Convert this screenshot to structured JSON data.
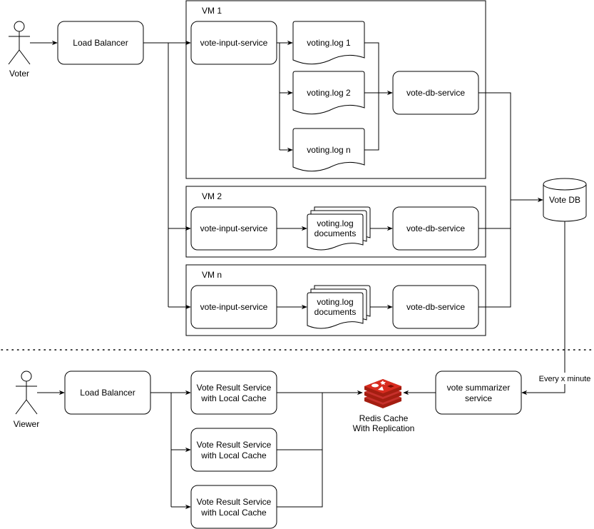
{
  "write_path": {
    "actor": "Voter",
    "load_balancer": "Load Balancer",
    "vms": [
      {
        "title": "VM 1",
        "input_service": "vote-input-service",
        "logs": [
          "voting.log 1",
          "voting.log 2",
          "voting.log n"
        ],
        "db_service": "vote-db-service"
      },
      {
        "title": "VM 2",
        "input_service": "vote-input-service",
        "logs_label": [
          "voting.log",
          "documents"
        ],
        "db_service": "vote-db-service"
      },
      {
        "title": "VM n",
        "input_service": "vote-input-service",
        "logs_label": [
          "voting.log",
          "documents"
        ],
        "db_service": "vote-db-service"
      }
    ],
    "database": "Vote DB"
  },
  "read_path": {
    "actor": "Viewer",
    "load_balancer": "Load Balancer",
    "result_services": [
      [
        "Vote Result Service",
        "with Local Cache"
      ],
      [
        "Vote Result Service",
        "with Local Cache"
      ],
      [
        "Vote Result Service",
        "with Local Cache"
      ]
    ],
    "cache": [
      "Redis Cache",
      "With Replication"
    ],
    "summarizer": [
      "vote summarizer",
      "service"
    ],
    "schedule_label": "Every x minute"
  },
  "colors": {
    "redis_red": "#c6302b",
    "redis_dark": "#a41e11",
    "stroke": "#000000"
  }
}
